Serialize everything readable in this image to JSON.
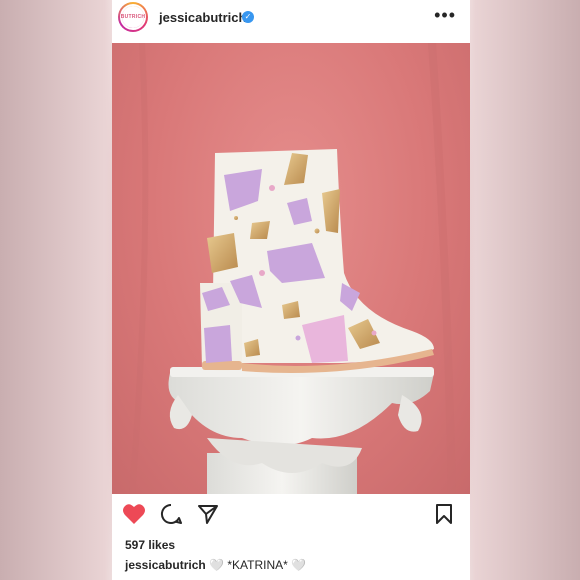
{
  "profile": {
    "username": "jessicabutrich",
    "avatar_text": "BUTRICH",
    "verified": true
  },
  "icons": {
    "more": "more-options-icon",
    "like": "heart-filled-icon",
    "comment": "comment-icon",
    "share": "send-icon",
    "save": "bookmark-icon"
  },
  "post": {
    "image_subject": "white ankle boot with pastel geometric patches on a white column",
    "likes": "597 likes",
    "caption_user": "jessicabutrich",
    "caption_text": "🤍 *KATRINA* 🤍"
  },
  "colors": {
    "like_red": "#ed4956",
    "verified_blue": "#3897f0",
    "backdrop_pink": "#d97878"
  }
}
